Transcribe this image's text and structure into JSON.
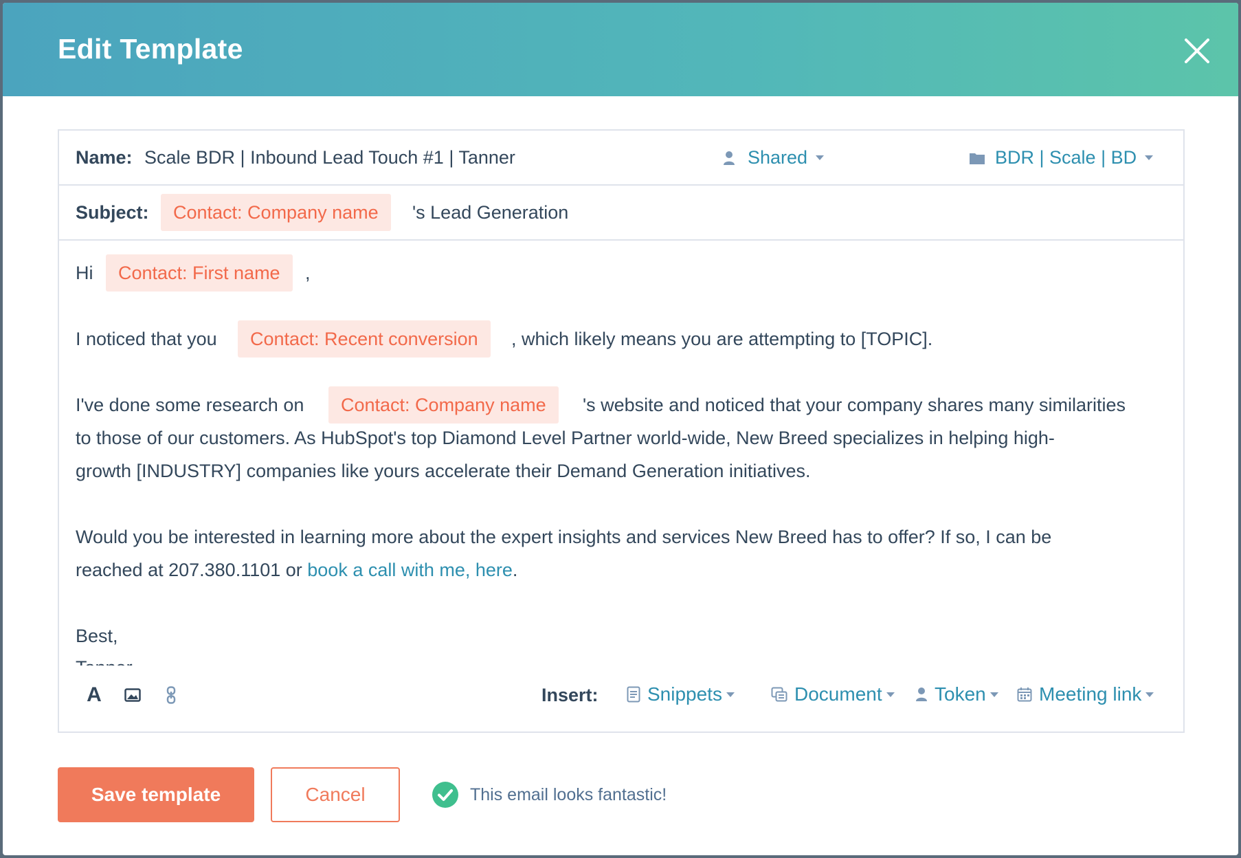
{
  "modal": {
    "title": "Edit Template",
    "close_icon": "close-icon"
  },
  "name_row": {
    "label": "Name:",
    "value": "Scale BDR | Inbound Lead Touch #1 | Tanner",
    "sharing": {
      "icon": "user-icon",
      "label": "Shared"
    },
    "folder": {
      "icon": "folder-icon",
      "label": "BDR | Scale | BD"
    }
  },
  "subject_row": {
    "label": "Subject:",
    "token": "Contact: Company name",
    "suffix": "'s Lead Generation"
  },
  "body": {
    "greeting": "Hi",
    "greeting_token": "Contact: First name",
    "greeting_comma": ",",
    "p1_start": "I noticed that you",
    "p1_token": "Contact: Recent conversion",
    "p1_end": ", which likely means you are attempting to [TOPIC].",
    "p2_start": "I've done some research on",
    "p2_token": "Contact: Company name",
    "p2_line1_end": "'s website and noticed that your company shares many similarities",
    "p2_line2": "to those of our customers. As HubSpot's top Diamond Level Partner world-wide, New Breed specializes in helping high-",
    "p2_line3": "growth [INDUSTRY] companies like yours accelerate their Demand Generation initiatives.",
    "p3_line1": "Would you be interested in learning more about the expert insights and services New Breed has to offer? If so, I can be",
    "p3_line2_start": "reached at 207.380.1101 or ",
    "p3_link": "book a call with me, here",
    "p3_line2_end": ".",
    "signoff": "Best,",
    "signature": "Tanner"
  },
  "toolbar": {
    "format_icon": "text-format-icon",
    "image_icon": "image-icon",
    "link_icon": "link-icon",
    "insert_label": "Insert:",
    "snippets": "Snippets",
    "document": "Document",
    "token": "Token",
    "meeting_link": "Meeting link"
  },
  "footer": {
    "save_label": "Save template",
    "cancel_label": "Cancel",
    "status_text": "This email looks fantastic!"
  },
  "colors": {
    "accent_teal": "#2d8faf",
    "token_text": "#f2694a",
    "token_bg": "#fde8e3",
    "primary_button": "#f07a5b",
    "success_green": "#3fbf8e"
  }
}
